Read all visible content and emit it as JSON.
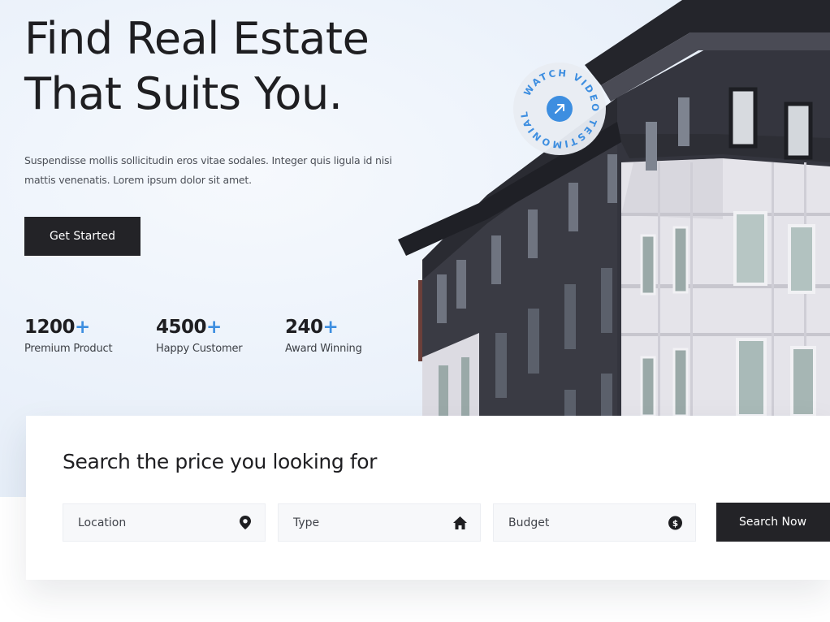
{
  "hero": {
    "title_line1": "Find Real Estate",
    "title_line2": "That Suits You.",
    "description": "Suspendisse mollis sollicitudin eros vitae sodales. Integer quis ligula id nisi mattis venenatis. Lorem ipsum dolor sit amet.",
    "cta_label": "Get Started"
  },
  "stats": [
    {
      "value": "1200",
      "plus": "+",
      "label": "Premium Product"
    },
    {
      "value": "4500",
      "plus": "+",
      "label": "Happy Customer"
    },
    {
      "value": "240",
      "plus": "+",
      "label": "Award Winning"
    }
  ],
  "video_badge": {
    "text": "WATCH VIDEO TESTIMONIAL",
    "icon": "arrow-up-right-icon"
  },
  "search": {
    "title": "Search the price you looking for",
    "fields": [
      {
        "label": "Location",
        "icon": "location-pin-icon"
      },
      {
        "label": "Type",
        "icon": "home-icon"
      },
      {
        "label": "Budget",
        "icon": "dollar-coin-icon"
      }
    ],
    "button_label": "Search Now"
  },
  "colors": {
    "accent": "#3d8ee0",
    "dark": "#232327",
    "background": "#edf3fb"
  }
}
